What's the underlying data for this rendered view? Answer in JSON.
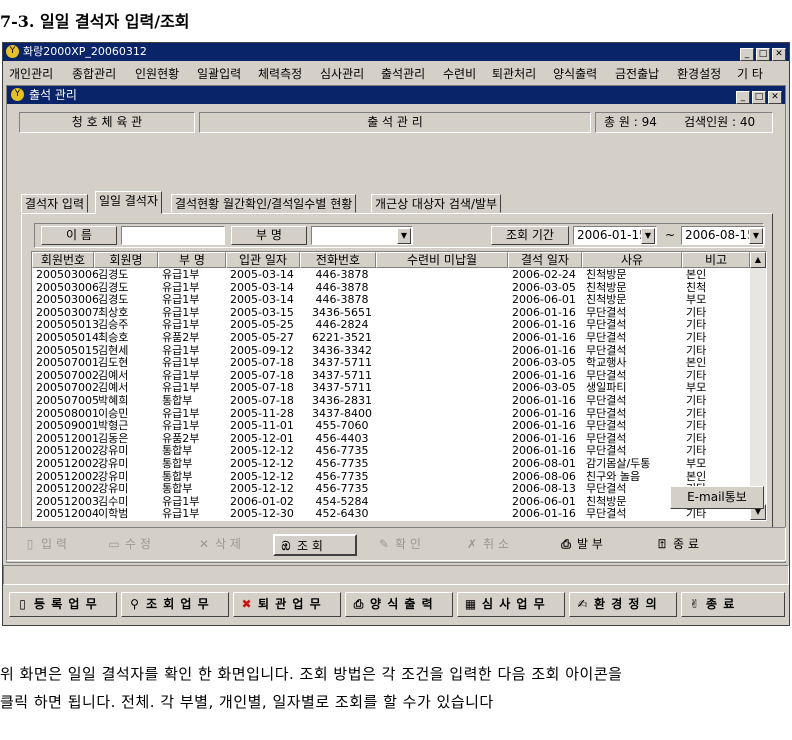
{
  "heading": "7-3. 일일 결석자 입력/조회",
  "app": {
    "title": "화랑2000XP_20060312",
    "menu": [
      "개인관리",
      "종합관리",
      "인원현황",
      "일괄입력",
      "체력측정",
      "심사관리",
      "출석관리",
      "수련비",
      "퇴관처리",
      "양식출력",
      "금전출납",
      "환경설정",
      "기 타"
    ]
  },
  "window": {
    "title": "출석 관리",
    "org_name": "청 호 체 육 관",
    "center_title": "출 석 관 리",
    "total_label": "총 원 : 94",
    "search_label": "검색인원 : 40"
  },
  "tabs": [
    "결석자 입력",
    "일일 결석자",
    "결석현황 월간확인/결석일수별 현황",
    "개근상 대상자 검색/발부"
  ],
  "filters": {
    "name_label": "이 름",
    "name_value": "",
    "dept_label": "부 명",
    "dept_value": "",
    "period_label": "조회 기간",
    "date_from": "2006-01-15",
    "tilde": "~",
    "date_to": "2006-08-15"
  },
  "table": {
    "columns": [
      "회원번호",
      "회원명",
      "부 명",
      "입관 일자",
      "전화번호",
      "수련비 미납월",
      "결석 일자",
      "사유",
      "비고"
    ],
    "rows": [
      [
        "200503006",
        "김경도",
        "유급1부",
        "2005-03-14",
        "446-3878",
        "",
        "2006-02-24",
        "친척방문",
        "본인"
      ],
      [
        "200503006",
        "김경도",
        "유급1부",
        "2005-03-14",
        "446-3878",
        "",
        "2006-03-05",
        "친척방문",
        "친척"
      ],
      [
        "200503006",
        "김경도",
        "유급1부",
        "2005-03-14",
        "446-3878",
        "",
        "2006-06-01",
        "친척방문",
        "부모"
      ],
      [
        "200503007",
        "최상호",
        "유급1부",
        "2005-03-15",
        "3436-5651",
        "",
        "2006-01-16",
        "무단결석",
        "기타"
      ],
      [
        "200505013",
        "김승주",
        "유급1부",
        "2005-05-25",
        "446-2824",
        "",
        "2006-01-16",
        "무단결석",
        "기타"
      ],
      [
        "200505014",
        "최승호",
        "유품2부",
        "2005-05-27",
        "6221-3521",
        "",
        "2006-01-16",
        "무단결석",
        "기타"
      ],
      [
        "200505015",
        "김현세",
        "유급1부",
        "2005-09-12",
        "3436-3342",
        "",
        "2006-01-16",
        "무단결석",
        "기타"
      ],
      [
        "200507001",
        "김도현",
        "유급1부",
        "2005-07-18",
        "3437-5711",
        "",
        "2006-03-05",
        "학교행사",
        "본인"
      ],
      [
        "200507002",
        "김예서",
        "유급1부",
        "2005-07-18",
        "3437-5711",
        "",
        "2006-01-16",
        "무단결석",
        "기타"
      ],
      [
        "200507002",
        "김예서",
        "유급1부",
        "2005-07-18",
        "3437-5711",
        "",
        "2006-03-05",
        "생일파티",
        "부모"
      ],
      [
        "200507005",
        "박혜희",
        "통합부",
        "2005-07-18",
        "3436-2831",
        "",
        "2006-01-16",
        "무단결석",
        "기타"
      ],
      [
        "200508001",
        "이승민",
        "유급1부",
        "2005-11-28",
        "3437-8400",
        "",
        "2006-01-16",
        "무단결석",
        "기타"
      ],
      [
        "200509001",
        "박형근",
        "유급1부",
        "2005-11-01",
        "455-7060",
        "",
        "2006-01-16",
        "무단결석",
        "기타"
      ],
      [
        "200512001",
        "김동은",
        "유품2부",
        "2005-12-01",
        "456-4403",
        "",
        "2006-01-16",
        "무단결석",
        "기타"
      ],
      [
        "200512002",
        "강유미",
        "통합부",
        "2005-12-12",
        "456-7735",
        "",
        "2006-01-16",
        "무단결석",
        "기타"
      ],
      [
        "200512002",
        "강유미",
        "통합부",
        "2005-12-12",
        "456-7735",
        "",
        "2006-08-01",
        "감기몸살/두통",
        "부모"
      ],
      [
        "200512002",
        "강유미",
        "통합부",
        "2005-12-12",
        "456-7735",
        "",
        "2006-08-06",
        "친구와 놀음",
        "본인"
      ],
      [
        "200512002",
        "강유미",
        "통합부",
        "2005-12-12",
        "456-7735",
        "",
        "2006-08-13",
        "무단결석",
        "기타"
      ],
      [
        "200512003",
        "김수미",
        "유급1부",
        "2006-01-02",
        "454-5284",
        "",
        "2006-06-01",
        "친척방문",
        "본인"
      ],
      [
        "200512004",
        "이학범",
        "유급1부",
        "2005-12-30",
        "452-6430",
        "",
        "2006-01-16",
        "무단결석",
        "기타"
      ]
    ]
  },
  "email_button": "E-mail통보",
  "toolbar": {
    "input": "입    력",
    "edit": "수    정",
    "delete": "삭    제",
    "search": "조    회",
    "confirm": "확    인",
    "cancel": "취    소",
    "issue": "발    부",
    "exit": "종    료"
  },
  "bottom": {
    "register": "등 록 업 무",
    "query": "조 회 업 무",
    "withdraw": "퇴 관 업 무",
    "forms": "양 식 출 력",
    "review": "심 사 업 무",
    "settings": "환 경 정 의",
    "quit": "종           료"
  },
  "description": {
    "line1": "위 화면은 일일 결석자를 확인 한 화면입니다. 조회 방법은 각 조건을 입력한 다음 조회 아이콘을",
    "line2": "클릭 하면 됩니다. 전체. 각 부별, 개인별, 일자별로 조회를 할 수가 있습니다"
  },
  "icons": {
    "app": "app-logo-icon",
    "toolbar": [
      "document-icon",
      "edit-document-icon",
      "x-icon",
      "binoculars-icon",
      "pen-check-icon",
      "x-outline-icon",
      "printer-icon",
      "exit-door-icon"
    ],
    "bottom": [
      "document-icon",
      "magnifier-icon",
      "red-x-icon",
      "printer-icon",
      "calculator-icon",
      "settings-person-icon",
      "exit-icon"
    ]
  },
  "colors": {
    "titlebar": "#0a246a",
    "face": "#d4d0c8",
    "delete_x": "#d01010"
  }
}
